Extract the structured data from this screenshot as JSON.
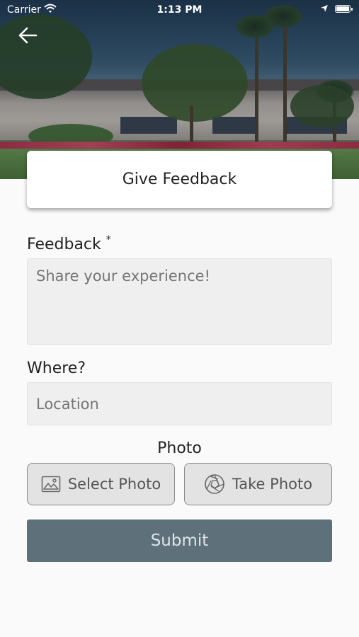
{
  "status_bar": {
    "carrier": "Carrier",
    "time": "1:13 PM"
  },
  "header": {
    "title": "Give Feedback",
    "back_icon": "arrow-left-icon"
  },
  "form": {
    "feedback": {
      "label": "Feedback",
      "required_marker": "*",
      "placeholder": "Share your experience!",
      "value": ""
    },
    "where": {
      "label": "Where?",
      "placeholder": "Location",
      "value": ""
    },
    "photo": {
      "label": "Photo",
      "select_label": "Select Photo",
      "select_icon": "image-icon",
      "take_label": "Take Photo",
      "take_icon": "camera-aperture-icon"
    },
    "submit_label": "Submit"
  },
  "colors": {
    "submit_bg": "#5e707a",
    "field_bg": "#efefef",
    "page_bg": "#fafafa"
  }
}
